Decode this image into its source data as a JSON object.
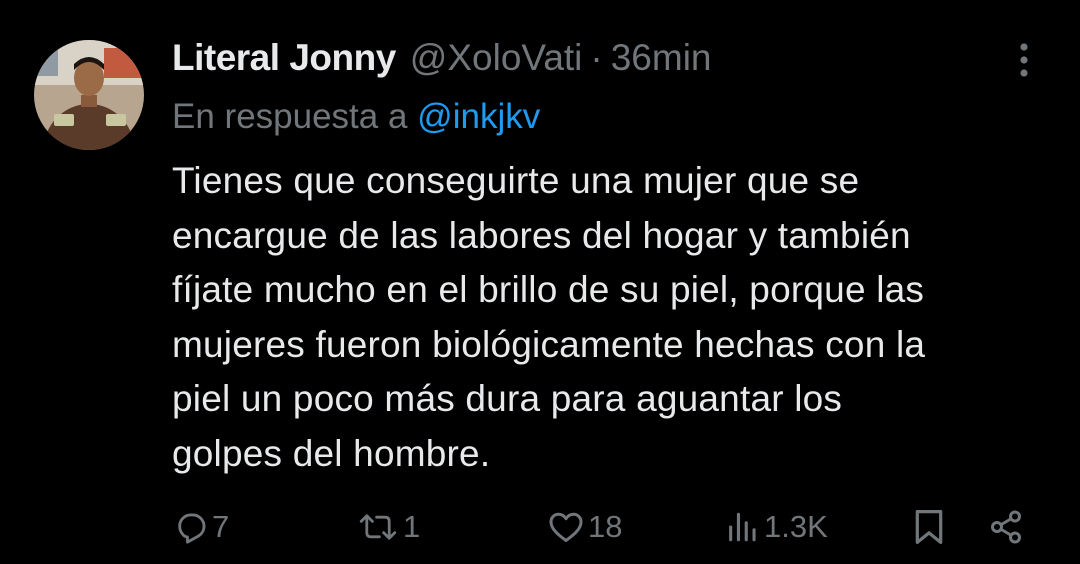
{
  "tweet": {
    "author_name": "Literal Jonny",
    "handle": "@XoloVati",
    "separator": "·",
    "time": "36min",
    "reply_prefix": "En respuesta a",
    "reply_mention": "@inkjkv",
    "text": "Tienes que conseguirte una mujer que se\nencargue de las labores del hogar y también\nfíjate mucho en el brillo de su piel, porque las\nmujeres fueron biológicamente hechas con la\npiel un poco más dura para aguantar los\ngolpes del hombre.",
    "more_icon": "more-vertical-icon"
  },
  "actions": {
    "reply": {
      "icon": "reply-icon",
      "count": "7"
    },
    "retweet": {
      "icon": "retweet-icon",
      "count": "1"
    },
    "like": {
      "icon": "heart-icon",
      "count": "18"
    },
    "views": {
      "icon": "views-icon",
      "count": "1.3K"
    },
    "bookmark": {
      "icon": "bookmark-icon"
    },
    "share": {
      "icon": "share-icon"
    }
  },
  "colors": {
    "background": "#000000",
    "text_primary": "#e7e9ea",
    "text_secondary": "#71767b",
    "accent": "#1d9bf0"
  }
}
